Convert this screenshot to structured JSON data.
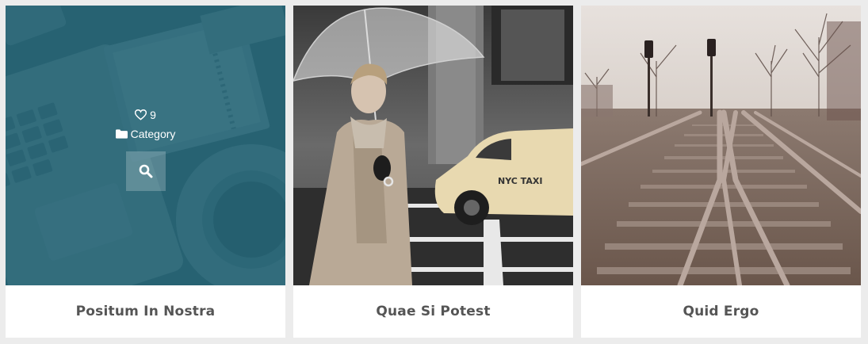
{
  "items": [
    {
      "title": "Positum In Nostra",
      "likes": "9",
      "category": "Category",
      "hovered": true
    },
    {
      "title": "Quae Si Potest",
      "hovered": false,
      "taxi_text": "NYC TAXI"
    },
    {
      "title": "Quid Ergo",
      "hovered": false
    }
  ],
  "colors": {
    "overlay": "#266678",
    "caption_text": "#555555",
    "background": "#ececec"
  },
  "icons": {
    "like": "heart-icon",
    "category": "folder-icon",
    "search": "search-icon"
  }
}
